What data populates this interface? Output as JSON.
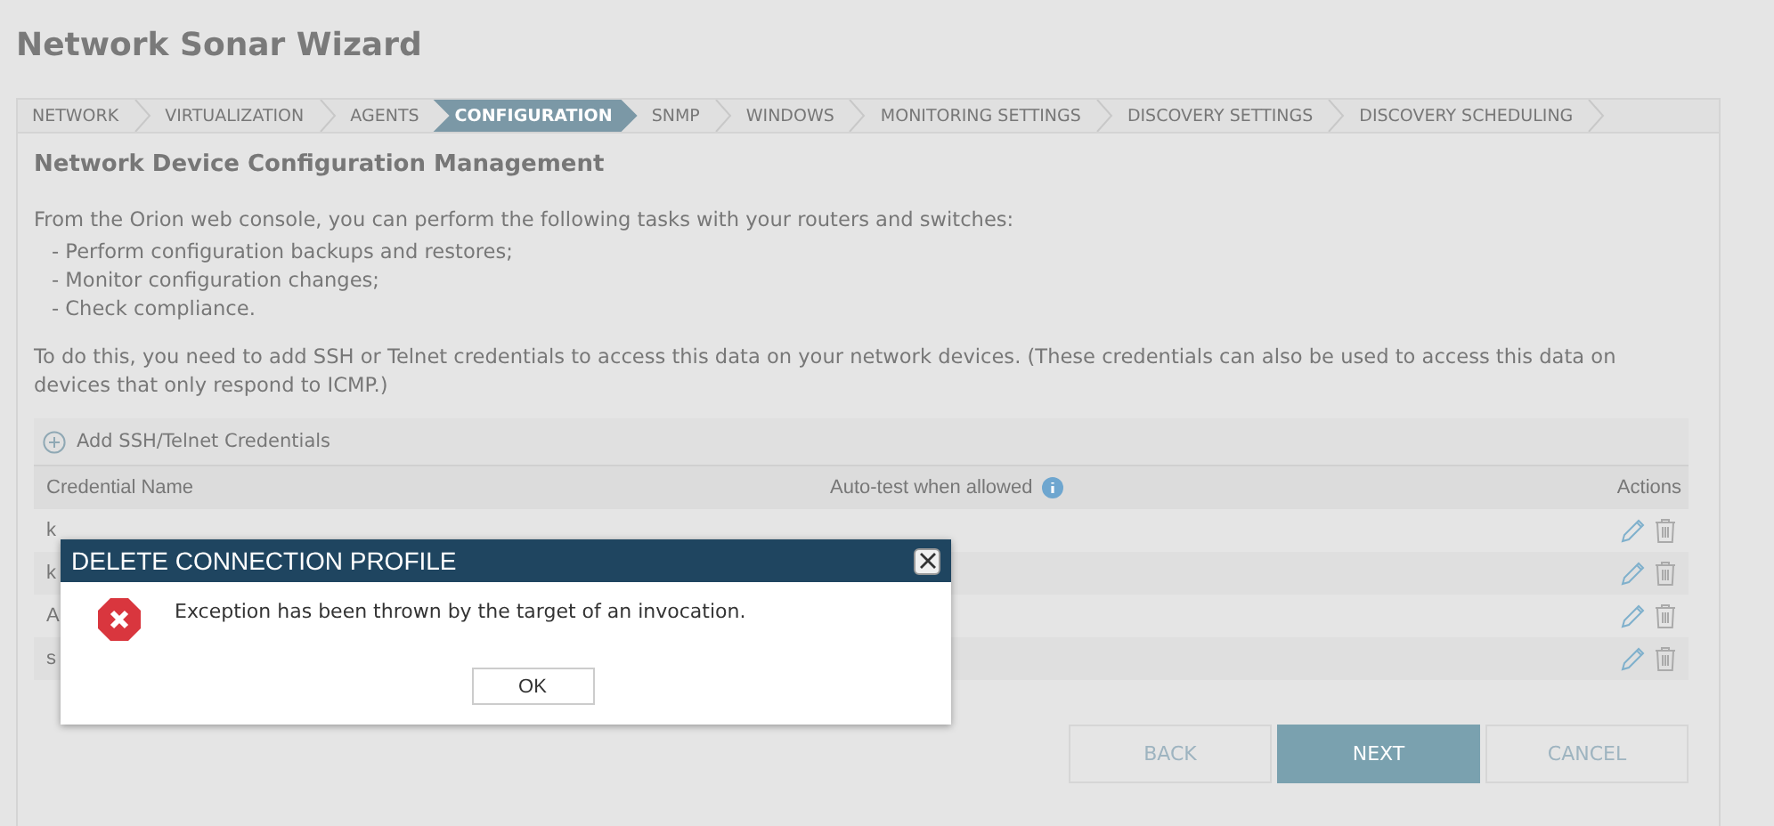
{
  "window": {
    "title": "Network Sonar Wizard"
  },
  "steps": [
    {
      "label": "NETWORK",
      "selected": false
    },
    {
      "label": "VIRTUALIZATION",
      "selected": false
    },
    {
      "label": "AGENTS",
      "selected": false
    },
    {
      "label": "CONFIGURATION",
      "selected": true
    },
    {
      "label": "SNMP",
      "selected": false
    },
    {
      "label": "WINDOWS",
      "selected": false
    },
    {
      "label": "MONITORING SETTINGS",
      "selected": false
    },
    {
      "label": "DISCOVERY SETTINGS",
      "selected": false
    },
    {
      "label": "DISCOVERY SCHEDULING",
      "selected": false
    }
  ],
  "section": {
    "heading": "Network Device Configuration Management",
    "intro": "From the Orion web console, you can perform the following tasks with your routers and switches:",
    "tasks": [
      "- Perform configuration backups and restores;",
      "- Monitor configuration changes;",
      "- Check compliance."
    ],
    "note": "To do this, you need to add SSH or Telnet credentials to access this data on your network devices. (These credentials can also be used to access this data on devices that only respond to ICMP.)"
  },
  "add_button": "Add SSH/Telnet Credentials",
  "table": {
    "columns": [
      "Credential Name",
      "Auto-test when allowed",
      "Actions"
    ],
    "rows": [
      {
        "name": "k"
      },
      {
        "name": "k"
      },
      {
        "name": "A"
      },
      {
        "name": "s"
      }
    ]
  },
  "dialog": {
    "title": "DELETE CONNECTION PROFILE",
    "message": "Exception has been thrown by the target of an invocation.",
    "button": "OK"
  },
  "buttons": [
    {
      "label": "BACK",
      "kind": "secondary"
    },
    {
      "label": "NEXT",
      "kind": "primary"
    },
    {
      "label": "CANCEL",
      "kind": "secondary"
    }
  ]
}
